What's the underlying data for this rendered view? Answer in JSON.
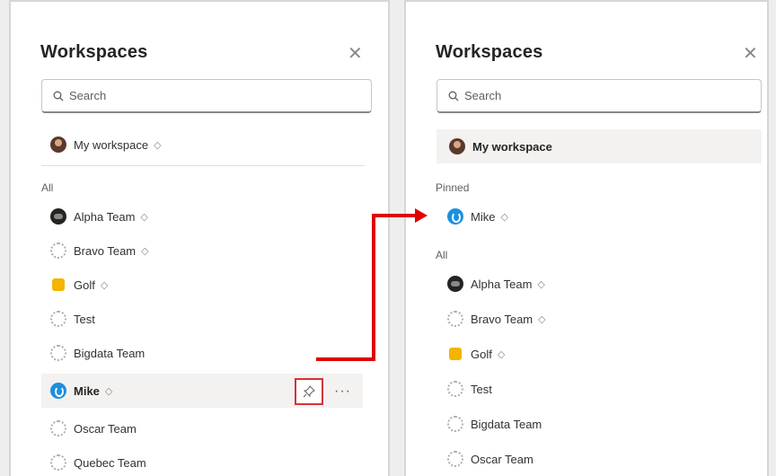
{
  "left": {
    "title": "Workspaces",
    "search_placeholder": "Search",
    "my_workspace": "My workspace",
    "section_all": "All",
    "items": [
      "Alpha Team",
      "Bravo Team",
      "Golf",
      "Test",
      "Bigdata Team",
      "Mike",
      "Oscar Team",
      "Quebec Team"
    ],
    "more": "···"
  },
  "right": {
    "title": "Workspaces",
    "search_placeholder": "Search",
    "my_workspace": "My workspace",
    "section_pinned": "Pinned",
    "pinned": [
      "Mike"
    ],
    "section_all": "All",
    "items": [
      "Alpha Team",
      "Bravo Team",
      "Golf",
      "Test",
      "Bigdata Team",
      "Oscar Team"
    ]
  },
  "symbols": {
    "diamond": "◇",
    "close": "✕"
  },
  "colors": {
    "accent_red": "#e00000",
    "pin_border": "#d13438",
    "selected_bg": "#f3f2f1"
  }
}
